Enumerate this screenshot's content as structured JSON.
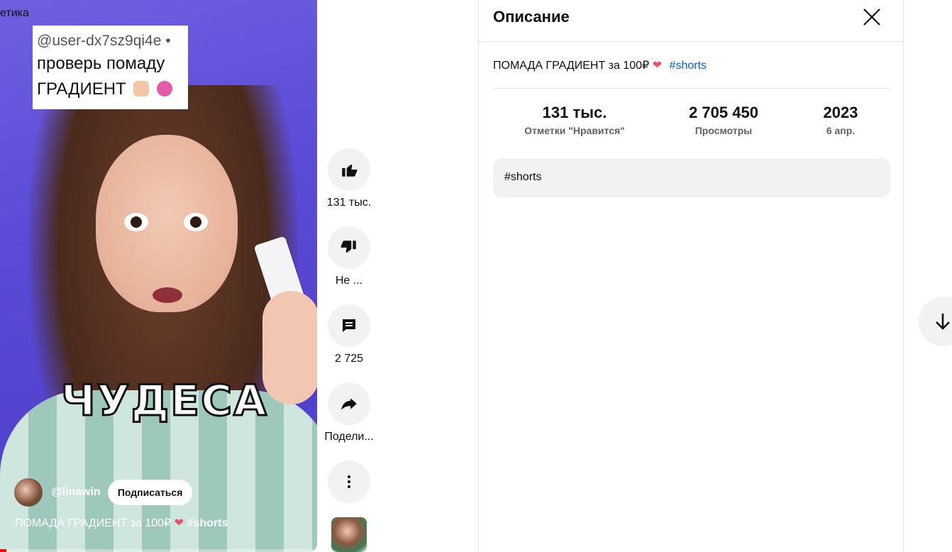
{
  "player": {
    "cut_title": "етика",
    "overlay_user": "@user-dx7sz9qi4e  •",
    "overlay_line1": "проверь помаду",
    "overlay_line2": "ГРАДИЕНТ",
    "big_word": "ЧУДЕСА",
    "channel_name": "@linawin",
    "subscribe_label": "Подписаться",
    "caption_text": "ПОМАДА ГРАДИЕНТ за 100₽",
    "caption_tag": "#shorts",
    "progress": 0.02
  },
  "actions": {
    "like_count": "131 тыс.",
    "dislike_label": "Не ...",
    "comment_count": "2 725",
    "share_label": "Подели..."
  },
  "description": {
    "title": "Описание",
    "text": "ПОМАДА ГРАДИЕНТ за 100₽",
    "hashtag": "#shorts",
    "stats": [
      {
        "value": "131 тыс.",
        "label": "Отметки \"Нравится\""
      },
      {
        "value": "2 705 450",
        "label": "Просмотры"
      },
      {
        "value": "2023",
        "label": "6 апр."
      }
    ],
    "tag_box": "#shorts"
  },
  "colors": {
    "accent_link": "#065fd4",
    "progress": "#ff0000",
    "heart": "#e0566f"
  }
}
